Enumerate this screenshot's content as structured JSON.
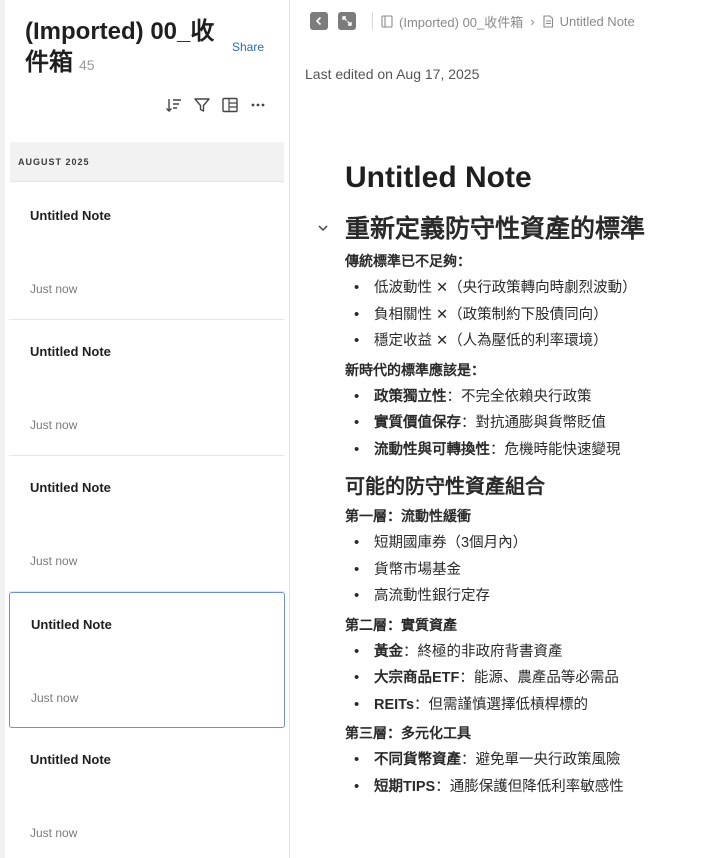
{
  "sidebar": {
    "folder_title": "(Imported) 00_收件箱",
    "note_count": "45",
    "share_label": "Share",
    "toolbar_icons": [
      "sort-icon",
      "filter-icon",
      "layout-icon",
      "more-icon"
    ],
    "month_header": "AUGUST 2025",
    "notes": [
      {
        "title": "Untitled Note",
        "time": "Just now"
      },
      {
        "title": "Untitled Note",
        "time": "Just now"
      },
      {
        "title": "Untitled Note",
        "time": "Just now"
      },
      {
        "title": "Untitled Note",
        "time": "Just now"
      },
      {
        "title": "Untitled Note",
        "time": "Just now"
      }
    ],
    "selected_index": 3
  },
  "topbar": {
    "breadcrumb": [
      "(Imported) 00_收件箱",
      "Untitled Note"
    ]
  },
  "editor": {
    "last_edited": "Last edited on Aug 17, 2025",
    "title": "Untitled Note",
    "h1": "重新定義防守性資產的標準",
    "sec1_sub": "傳統標準已不足夠：",
    "sec1_items": [
      "低波動性 ✕（央行政策轉向時劇烈波動）",
      "負相關性 ✕（政策制約下股債同向）",
      "穩定收益 ✕（人為壓低的利率環境）"
    ],
    "sec2_sub": "新時代的標準應該是：",
    "sec2_items": [
      {
        "bold": "政策獨立性",
        "rest": "：不完全依賴央行政策"
      },
      {
        "bold": "實質價值保存",
        "rest": "：對抗通膨與貨幣貶值"
      },
      {
        "bold": "流動性與可轉換性",
        "rest": "：危機時能快速變現"
      }
    ],
    "h2": "可能的防守性資產組合",
    "layer1_sub": "第一層：流動性緩衝",
    "layer1_items": [
      "短期國庫券（3個月內）",
      "貨幣市場基金",
      "高流動性銀行定存"
    ],
    "layer2_sub": "第二層：實質資產",
    "layer2_items": [
      {
        "bold": "黃金",
        "rest": "：終極的非政府背書資產"
      },
      {
        "bold": "大宗商品ETF",
        "rest": "：能源、農產品等必需品"
      },
      {
        "bold": "REITs",
        "rest": "：但需謹慎選擇低槓桿標的"
      }
    ],
    "layer3_sub": "第三層：多元化工具",
    "layer3_items": [
      {
        "bold": "不同貨幣資產",
        "rest": "：避免單一央行政策風險"
      },
      {
        "bold": "短期TIPS",
        "rest": "：通膨保護但降低利率敏感性"
      }
    ]
  }
}
